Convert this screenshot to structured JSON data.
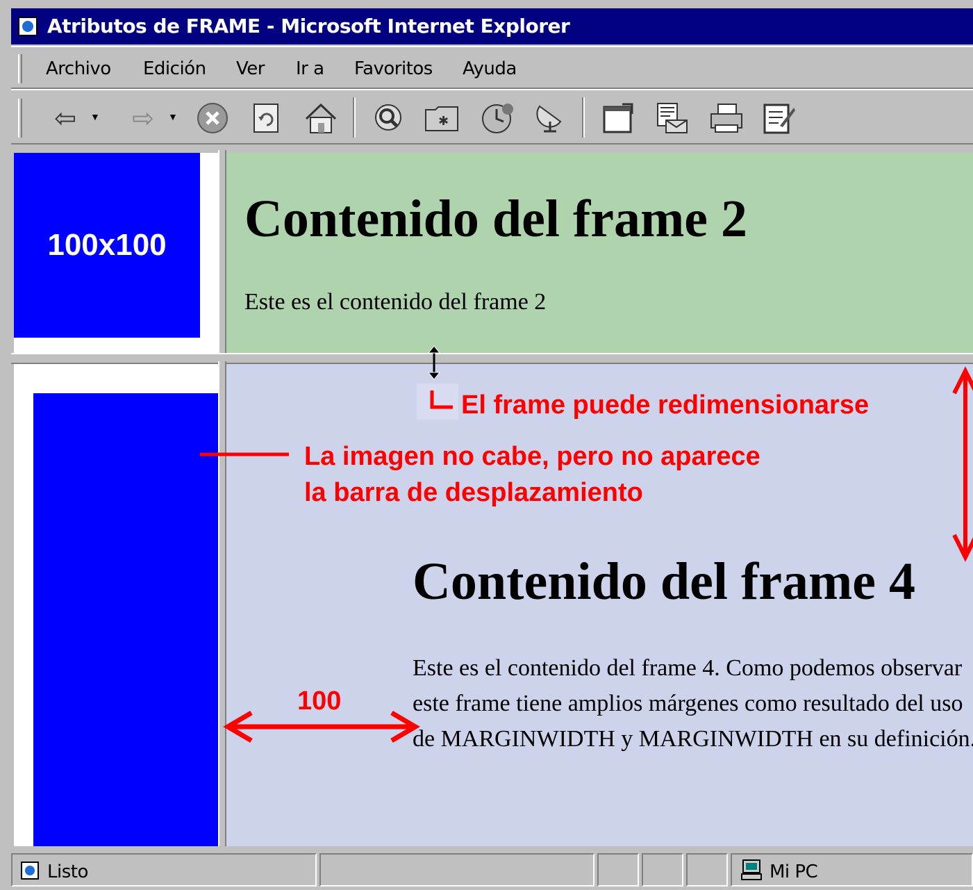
{
  "window": {
    "title": "Atributos de FRAME - Microsoft Internet Explorer",
    "icon": "ie-page-icon"
  },
  "menu": {
    "items": [
      "Archivo",
      "Edición",
      "Ver",
      "Ir a",
      "Favoritos",
      "Ayuda"
    ]
  },
  "toolbar": {
    "buttons": [
      "back-icon",
      "forward-icon",
      "stop-icon",
      "refresh-icon",
      "home-icon",
      "search-icon",
      "favorites-icon",
      "history-icon",
      "channels-icon",
      "fullscreen-icon",
      "mail-icon",
      "print-icon",
      "edit-icon"
    ]
  },
  "frame1": {
    "image_label": "100x100",
    "bg": "#0000ff"
  },
  "frame2": {
    "heading": "Contenido del frame 2",
    "text": "Este es el contenido del frame 2",
    "bg": "#afd4ad"
  },
  "frame4": {
    "heading": "Contenido del frame 4",
    "text": "Este es el contenido del frame 4. Como podemos observar este frame tiene amplios márgenes como resultado del uso de MARGINWIDTH y MARGINWIDTH en su definición.",
    "bg": "#cdd3ea"
  },
  "annotations": {
    "resize": "El frame puede redimensionarse",
    "image_line1": "La imagen no cabe, pero no aparece",
    "image_line2": "la barra de desplazamiento",
    "margin": "100",
    "color": "#ff0000"
  },
  "status": {
    "text": "Listo",
    "zone": "Mi PC"
  }
}
